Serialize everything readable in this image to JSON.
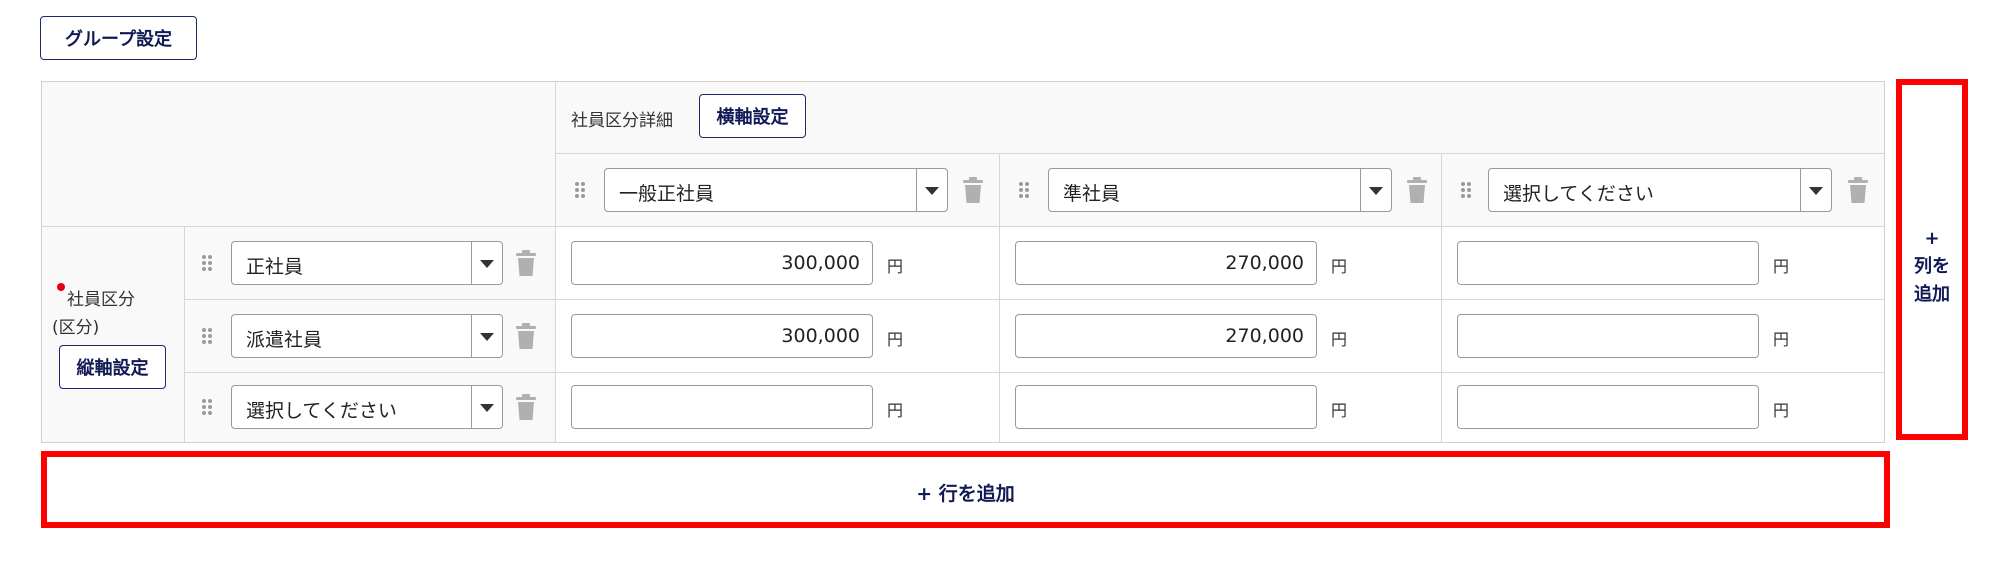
{
  "group_settings_label": "グループ設定",
  "header": {
    "detail_label": "社員区分詳細",
    "horizontal_axis_button": "横軸設定",
    "columns": [
      {
        "selected": "一般正社員"
      },
      {
        "selected": "準社員"
      },
      {
        "selected": "選択してください"
      }
    ]
  },
  "row_header": {
    "label_line1": "社員区分",
    "label_line2": "(区分)",
    "vertical_axis_button": "縦軸設定"
  },
  "rows": [
    {
      "selected": "正社員",
      "values": [
        "300,000",
        "270,000",
        ""
      ]
    },
    {
      "selected": "派遣社員",
      "values": [
        "300,000",
        "270,000",
        ""
      ]
    },
    {
      "selected": "選択してください",
      "values": [
        "",
        "",
        ""
      ]
    }
  ],
  "unit": "円",
  "add_column": {
    "plus": "+",
    "line1": "列を",
    "line2": "追加"
  },
  "add_row_label": "+ 行を追加",
  "colors": {
    "accent": "#111a55",
    "highlight": "#ff0000",
    "required": "#e60012"
  }
}
